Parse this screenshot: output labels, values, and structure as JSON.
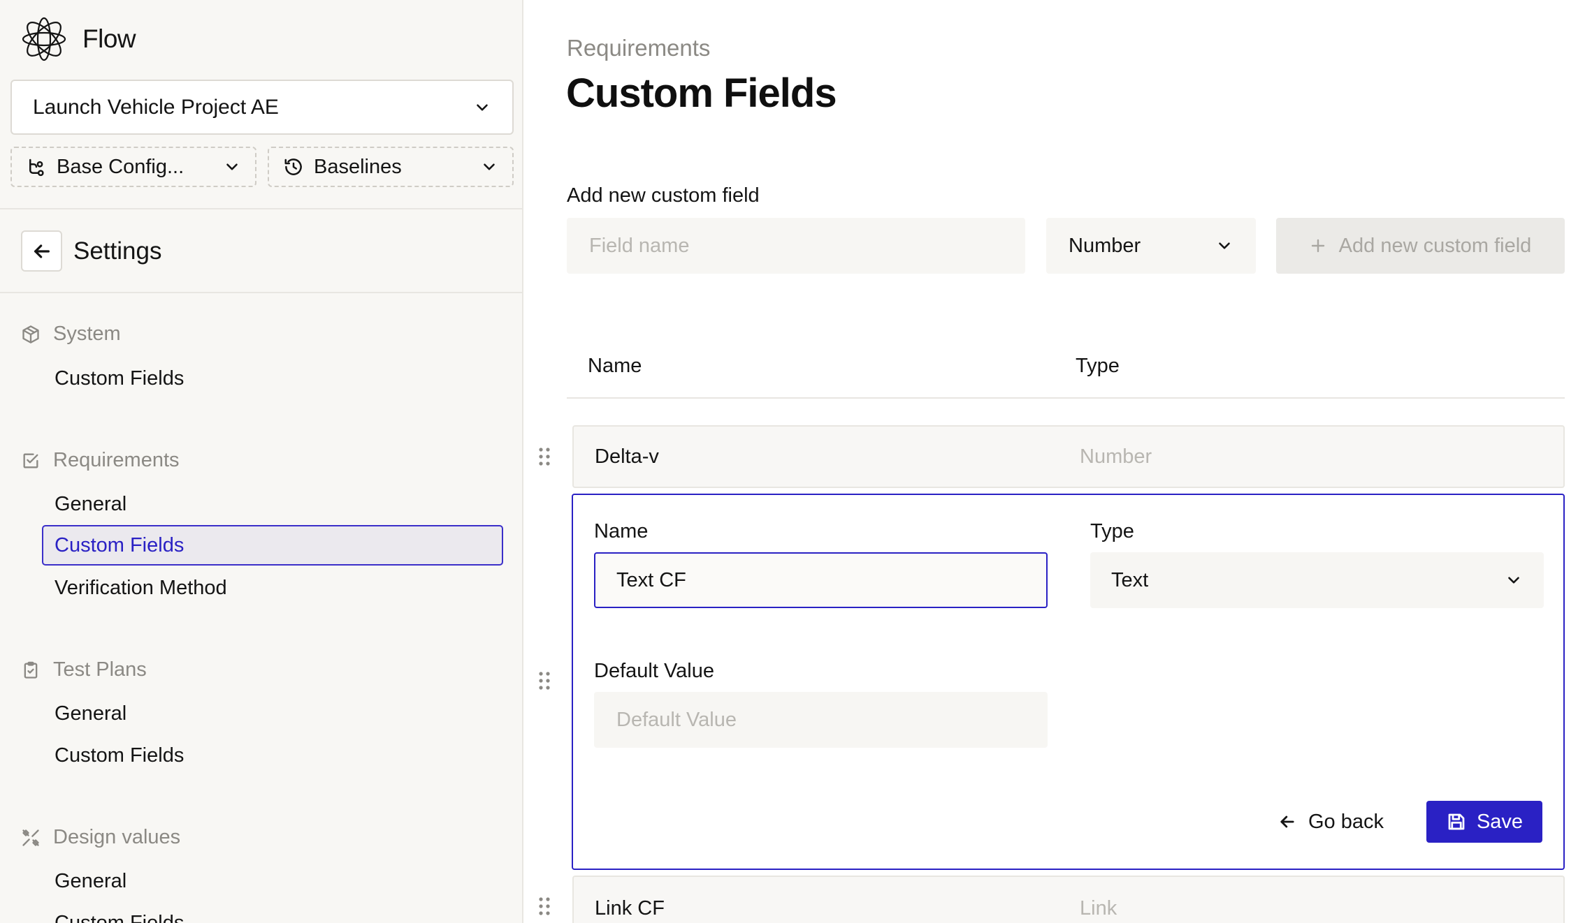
{
  "brand": {
    "name": "Flow"
  },
  "project_select": {
    "value": "Launch Vehicle Project AE"
  },
  "config_select": {
    "value": "Base Config..."
  },
  "baselines_select": {
    "value": "Baselines"
  },
  "settings": {
    "title": "Settings"
  },
  "nav": {
    "sections": [
      {
        "label": "System",
        "icon": "cube-icon",
        "items": [
          "Custom Fields"
        ]
      },
      {
        "label": "Requirements",
        "icon": "checkbox-icon",
        "items": [
          "General",
          "Custom Fields",
          "Verification Method"
        ]
      },
      {
        "label": "Test Plans",
        "icon": "clipboard-check-icon",
        "items": [
          "General",
          "Custom Fields"
        ]
      },
      {
        "label": "Design values",
        "icon": "tools-icon",
        "items": [
          "General",
          "Custom Fields"
        ]
      }
    ],
    "active": "Requirements / Custom Fields"
  },
  "main": {
    "breadcrumb": "Requirements",
    "title": "Custom Fields",
    "add_form": {
      "label": "Add new custom field",
      "field_placeholder": "Field name",
      "type_value": "Number",
      "add_button": "Add new custom field"
    },
    "table": {
      "headers": {
        "name": "Name",
        "type": "Type"
      },
      "rows": [
        {
          "name": "Delta-v",
          "type": "Number"
        },
        {
          "name": "Link CF",
          "type": "Link"
        }
      ]
    },
    "edit_card": {
      "name_label": "Name",
      "name_value": "Text CF",
      "type_label": "Type",
      "type_value": "Text",
      "default_label": "Default Value",
      "default_placeholder": "Default Value",
      "go_back": "Go back",
      "save": "Save"
    }
  },
  "colors": {
    "accent": "#2a21c4",
    "sidebar_bg": "#f8f7f4",
    "muted_text": "#8b8984",
    "placeholder_text": "#b8b6b1"
  }
}
